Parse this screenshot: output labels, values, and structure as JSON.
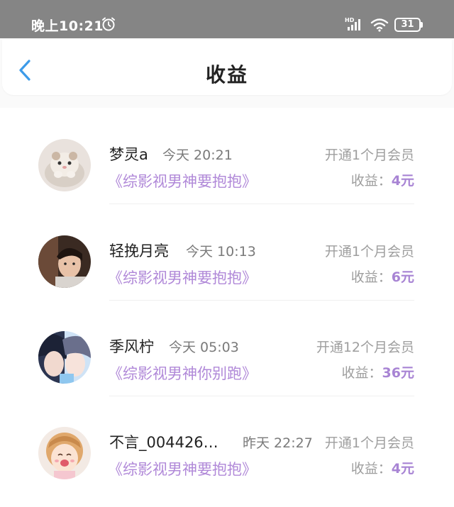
{
  "status_bar": {
    "time": "晚上10:21",
    "battery": "31",
    "icons": [
      "alarm-icon",
      "hd-signal-icon",
      "wifi-icon",
      "battery-icon"
    ]
  },
  "header": {
    "title": "收益",
    "back_icon": "chevron-left-icon"
  },
  "colors": {
    "accent": "#3d9be9",
    "novel_title": "#b088d8",
    "amount": "#a884d4",
    "status_bar_bg": "#858585"
  },
  "records": [
    {
      "username": "梦灵a",
      "time": "今天 20:21",
      "novel": "《综影视男神要抱抱》",
      "membership": "开通1个月会员",
      "earning_label": "收益：",
      "amount": "4元",
      "avatar": "hamster-avatar"
    },
    {
      "username": "轻挽月亮",
      "time": "今天 10:13",
      "novel": "《综影视男神要抱抱》",
      "membership": "开通1个月会员",
      "earning_label": "收益：",
      "amount": "6元",
      "avatar": "photo-avatar"
    },
    {
      "username": "季风柠",
      "time": "今天 05:03",
      "novel": "《综影视男神你别跑》",
      "membership": "开通12个月会员",
      "earning_label": "收益：",
      "amount": "36元",
      "avatar": "anime-avatar"
    },
    {
      "username": "不言_004426…",
      "time": "昨天 22:27",
      "novel": "《综影视男神要抱抱》",
      "membership": "开通1个月会员",
      "earning_label": "收益：",
      "amount": "4元",
      "avatar": "cartoon-girl-avatar"
    }
  ]
}
